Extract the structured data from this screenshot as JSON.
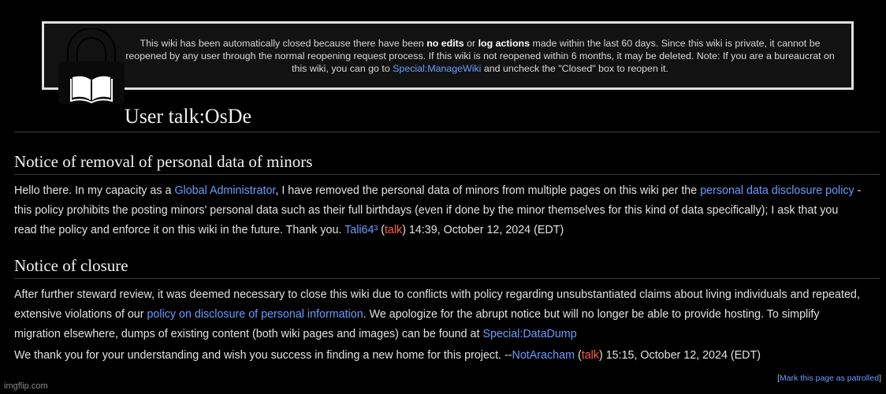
{
  "closure_notice": {
    "text_1": "This wiki has been automatically closed because there have been ",
    "bold_1": "no edits",
    "text_2": " or ",
    "bold_2": "log actions",
    "text_3": " made within the last 60 days. Since this wiki is private, it cannot be reopened by any user through the normal reopening request process. If this wiki is not reopened within 6 months, it may be deleted. Note: If you are a bureaucrat on this wiki, you can go to ",
    "link": "Special:ManageWiki",
    "text_4": " and uncheck the \"Closed\" box to reopen it."
  },
  "page": {
    "title": "User talk:OsDe"
  },
  "section1": {
    "heading": "Notice of removal of personal data of minors",
    "t1": "Hello there. In my capacity as a ",
    "link_admin": "Global Administrator",
    "t2": ", I have removed the personal data of minors from multiple pages on this wiki per the ",
    "link_policy": "personal data disclosure policy",
    "t3": " - this policy prohibits the posting minors' personal data such as their full birthdays (even if done by the minor themselves for this kind of data specifically); I ask that you read the policy and enforce it on this wiki in the future. Thank you. ",
    "user": "Tali64³",
    "paren_open": " (",
    "talk": "talk",
    "sig_time": ") 14:39, October 12, 2024 (EDT)"
  },
  "section2": {
    "heading": "Notice of closure",
    "t1": "After further steward review, it was deemed necessary to close this wiki due to conflicts with policy regarding unsubstantiated claims about living individuals and repeated, extensive violations of our ",
    "link_policy": "policy on disclosure of personal information",
    "t2": ". We apologize for the abrupt notice but will no longer be able to provide hosting. To simplify migration elsewhere, dumps of existing content (both wiki pages and images) can be found at ",
    "link_dump": "Special:DataDump",
    "t3": "We thank you for your understanding and wish you success in finding a new home for this project. --",
    "user": "NotAracham",
    "paren_open": " (",
    "talk": "talk",
    "sig_time": ") 15:15, October 12, 2024 (EDT)"
  },
  "footer": {
    "bracket_open": "[",
    "patrol_link": "Mark this page as patrolled",
    "bracket_close": "]",
    "watermark": "imgflip.com"
  },
  "icons": {
    "lock": "lock-book-icon"
  },
  "colors": {
    "background": "#000000",
    "link": "#6b9bff",
    "talk_link": "#ff5a4a",
    "banner_border": "#e0e0e0"
  }
}
